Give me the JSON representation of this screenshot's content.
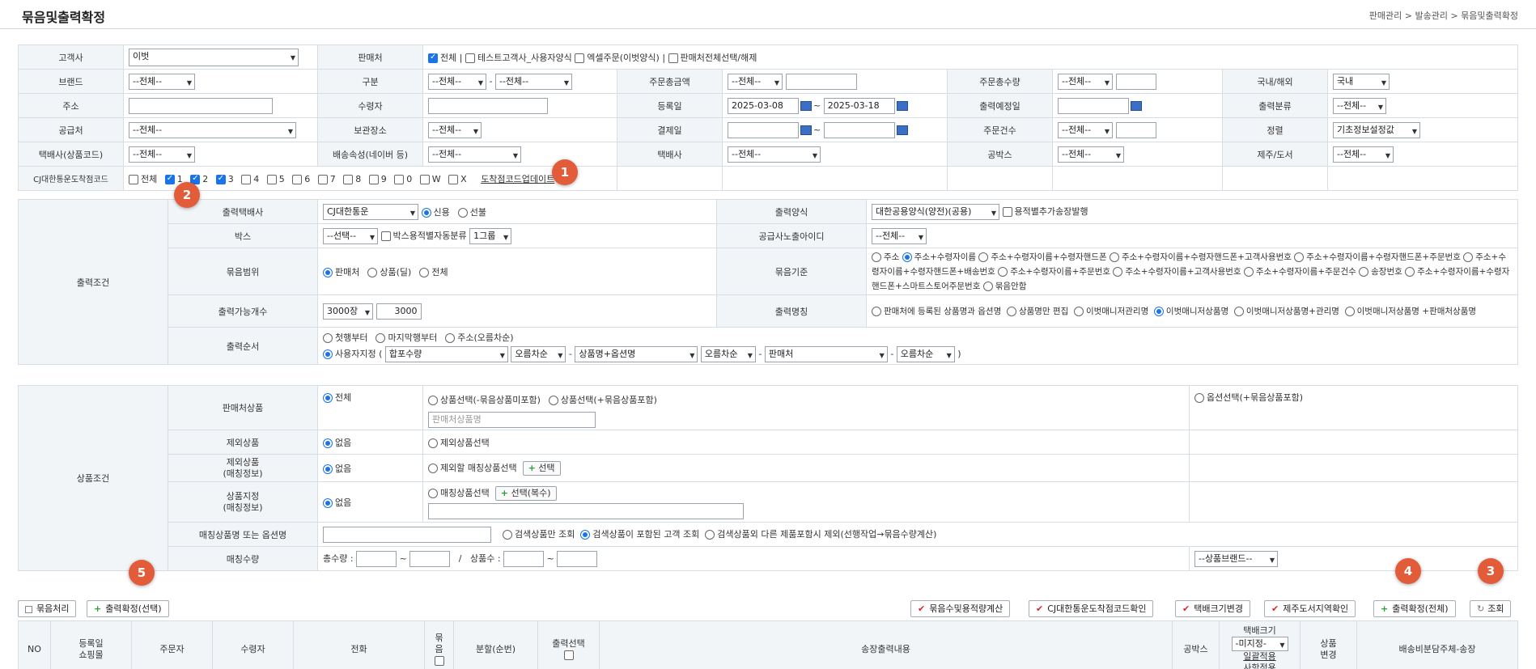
{
  "header": {
    "title": "묶음및출력확정",
    "breadcrumb": "판매관리 > 발송관리 > 묶음및출력확정"
  },
  "filters": {
    "customer_label": "고객사",
    "customer_value": "이벗",
    "seller_label": "판매처",
    "seller_all": "전체",
    "seller_opt1": "테스트고객사_사용자양식",
    "seller_opt2": "엑셀주문(이벗양식)",
    "seller_opt3": "판매처전체선택/해제",
    "brand_label": "브랜드",
    "all_value": "--전체--",
    "division_label": "구분",
    "order_amount_label": "주문총금액",
    "order_qty_label": "주문총수량",
    "domestic_label": "국내/해외",
    "domestic_value": "국내",
    "address_label": "주소",
    "recipient_label": "수령자",
    "reg_date_label": "등록일",
    "reg_date_from": "2025-03-08",
    "reg_date_to": "2025-03-18",
    "ship_date_label": "출력예정일",
    "ship_category_label": "출력분류",
    "supplier_label": "공급처",
    "storage_label": "보관장소",
    "pay_date_label": "결제일",
    "order_count_label": "주문건수",
    "sort_label": "정렬",
    "sort_value": "기초정보설정값",
    "courier_product_label": "택배사(상품코드)",
    "delivery_attr_label": "배송속성(네이버 등)",
    "courier_label": "택배사",
    "box_label": "공박스",
    "jeju_label": "제주/도서",
    "cj_label": "CJ대한통운도착점코드",
    "cj_all": "전체",
    "cj_codes": [
      "1",
      "2",
      "3",
      "4",
      "5",
      "6",
      "7",
      "8",
      "9",
      "0",
      "W",
      "X"
    ],
    "cj_link": "도착점코드업데이트"
  },
  "output": {
    "section_label": "출력조건",
    "courier_label": "출력택배사",
    "courier_value": "CJ대한통운",
    "new": "신용",
    "prepaid": "선불",
    "format_label": "출력양식",
    "format_value": "대한공용양식(양전)(공용)",
    "format_check": "용적별추가송장발행",
    "box_label": "박스",
    "box_value": "--선택--",
    "box_check": "박스용적별자동분류",
    "box_group": "1그룹",
    "supplier_id_label": "공급사노출아이디",
    "bundle_range_label": "묶음범위",
    "range_opts": [
      "판매처",
      "상품(딜)",
      "전체"
    ],
    "bundle_basis_label": "묶음기준",
    "basis_text1": "주소",
    "basis_text2": "주소+수령자이름",
    "basis_text3": "주소+수령자이름+수령자핸드폰",
    "basis_text4": "주소+수령자이름+수령자핸드폰+고객사용번호",
    "basis_text5": "주소+수령자이름+수령자핸드폰+주문번",
    "basis_text6": "호",
    "basis_text7": "주소+수령자이름+수령자핸드폰+배송번호",
    "basis_text8": "주소+수령자이름+주문번호",
    "basis_text9": "주소+수령자이름+고객사용번호",
    "basis_text10": "주소+수령자이름+주문건수",
    "basis_text11": "송장번",
    "basis_text12": "호",
    "basis_text13": "주소+수령자이름+수령자핸드폰+스마트스토어주문번호",
    "basis_text14": "묶음안함",
    "count_label": "출력가능개수",
    "count_select": "3000장",
    "count_value": "3000",
    "name_label": "출력명칭",
    "name_opt1": "판매처에 등록된 상품명과 옵션명",
    "name_opt2": "상품명만 편집",
    "name_opt3": "이벗매니저관리명",
    "name_opt4": "이벗매니저상품명",
    "name_opt5": "이벗매니저상품명+관리명",
    "name_opt6": "이벗매니저상품명",
    "name_opt7": "+판매처상품명",
    "order_label": "출력순서",
    "order_opts": [
      "첫행부터",
      "마지막행부터",
      "주소(오름차순)"
    ],
    "order_user": "사용자지정 (",
    "sort1": "합포수량",
    "dir1": "오름차순",
    "sort2": "상품명+옵션명",
    "dir2": "오름차순",
    "sort3": "판매처",
    "dir3": "오름차순"
  },
  "product": {
    "section_label": "상품조건",
    "seller_product_label": "판매처상품",
    "all": "전체",
    "opt_excl": "상품선택(-묶음상품미포함)",
    "opt_incl": "상품선택(+묶음상품포함)",
    "opt_option": "옵션선택(+묶음상품포함)",
    "placeholder": "판매처상품명",
    "exclude_label": "제외상품",
    "none": "없음",
    "exclude_select": "제외상품선택",
    "exclude_match_label1": "제외상품",
    "exclude_match_label2": "(매칭정보)",
    "exclude_match_select": "제외할 매칭상품선택",
    "select_btn": "선택",
    "designate_label1": "상품지정",
    "designate_label2": "(매칭정보)",
    "designate_select": "매칭상품선택",
    "select_multi_btn": "선택(복수)",
    "match_name_label": "매칭상품명 또는 옵션명",
    "search_only": "검색상품만 조회",
    "search_incl": "검색상품이 포함된 고객 조회",
    "search_excl": "검색상품외 다른 제품포함시 제외(선행작업→묶음수량계산)",
    "match_qty_label": "매칭수량",
    "total_qty": "총수량 :",
    "tilde": "~",
    "slash": "/",
    "product_count": "상품수 :",
    "brand_select": "--상품브랜드--"
  },
  "buttons": {
    "bundle": "묶음처리",
    "confirm_selected": "출력확정(선택)",
    "calc": "묶음수및용적량계산",
    "cj_check": "CJ대한통운도착점코드확인",
    "size_change": "택배크기변경",
    "jeju_check": "제주도서지역확인",
    "confirm_all": "출력확정(전체)",
    "search": "조회"
  },
  "results": {
    "no": "NO",
    "reg1": "등록일",
    "reg2": "쇼핑몰",
    "orderer": "주문자",
    "recipient": "수령자",
    "phone": "전화",
    "bundle1": "묶",
    "bundle2": "음",
    "split": "분할(순번)",
    "print_sel": "출력선택",
    "content": "송장출력내용",
    "box": "공박스",
    "size": "택배크기",
    "size_value": "-미지정-",
    "apply1": "일괄적용",
    "apply2": "사항적용",
    "change1": "상품",
    "change2": "변경",
    "shipping": "배송비분담주체-송장"
  },
  "badges": [
    "1",
    "2",
    "3",
    "4",
    "5"
  ],
  "colors": {
    "accent": "#1a73e8",
    "badge": "#e25c3a",
    "check": "#d9262e",
    "plus": "#2e9e3e",
    "label_bg": "#f2f5f8"
  }
}
